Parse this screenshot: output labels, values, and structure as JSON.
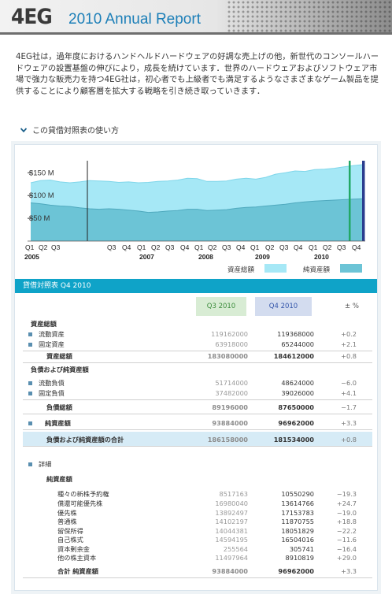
{
  "header": {
    "logo": "4EG",
    "title": "2010 Annual Report"
  },
  "intro": "4EG社は，過年度におけるハンドヘルドハードウェアの好調な売上げの他，新世代のコンソールハードウェアの設置基盤の伸びにより，成長を続けています．世界のハードウェアおよびソフトウェア市場で強力な販売力を持つ4EG社は，初心者でも上級者でも満足するようなさまざまなゲーム製品を提供することにより顧客層を拡大する戦略を引き続き取っていきます．",
  "howto": "この貸借対照表の使い方",
  "colors": {
    "accent": "#0fa3c8",
    "light_area": "#a6e8f6",
    "dark_area": "#6cc4d6",
    "marker_green": "#22a865",
    "marker_navy": "#2a3d8f"
  },
  "chart_data": {
    "type": "area",
    "y_ticks": [
      "$150 M",
      "$100 M",
      "$50 M"
    ],
    "x_quarter_labels": [
      "Q1",
      "Q2",
      "Q3",
      "Q3",
      "Q4",
      "Q1",
      "Q2",
      "Q3",
      "Q4",
      "Q1",
      "Q2",
      "Q3",
      "Q4",
      "Q1",
      "Q2",
      "Q3",
      "Q4",
      "Q1",
      "Q2",
      "Q3",
      "Q4"
    ],
    "year_labels": [
      "2005",
      "2007",
      "2008",
      "2009",
      "2010"
    ],
    "series": [
      {
        "name": "資産総額",
        "values": [
          128,
          133,
          134,
          130,
          128,
          130,
          133,
          132,
          131,
          129,
          130,
          128,
          129,
          131,
          132,
          134,
          138,
          137,
          131,
          131,
          132,
          136,
          138,
          136,
          140,
          147,
          150,
          154,
          153,
          157,
          158,
          160,
          163,
          166,
          168
        ]
      },
      {
        "name": "純資産額",
        "values": [
          84,
          82,
          79,
          77,
          76,
          73,
          71,
          70,
          71,
          70,
          68,
          66,
          63,
          64,
          66,
          67,
          70,
          70,
          67,
          68,
          69,
          72,
          74,
          75,
          77,
          79,
          81,
          84,
          86,
          88,
          89,
          90,
          91,
          92,
          93
        ]
      }
    ],
    "ylim": [
      0,
      180
    ]
  },
  "legend": {
    "total_assets": "資産総額",
    "net_assets": "純資産額"
  },
  "table": {
    "title": "貸借対照表 Q4 2010",
    "col_q3": "Q3 2010",
    "col_q4": "Q4 2010",
    "col_pct": "± %",
    "rows": [
      {
        "label": "資産総額",
        "type": "section"
      },
      {
        "label": "流動資産",
        "q3": "119162000",
        "q4": "119368000",
        "pct": "+0.2",
        "type": "bullet"
      },
      {
        "label": "固定資産",
        "q3": "63918000",
        "q4": "65244000",
        "pct": "+2.1",
        "type": "bullet"
      },
      {
        "label": "資産総額",
        "q3": "183080000",
        "q4": "184612000",
        "pct": "+0.8",
        "type": "total"
      },
      {
        "label": "負債および純資産額",
        "type": "section"
      },
      {
        "label": "流動負債",
        "q3": "51714000",
        "q4": "48624000",
        "pct": "−6.0",
        "type": "bullet"
      },
      {
        "label": "固定負債",
        "q3": "37482000",
        "q4": "39026000",
        "pct": "+4.1",
        "type": "bullet"
      },
      {
        "label": "負債総額",
        "q3": "89196000",
        "q4": "87650000",
        "pct": "−1.7",
        "type": "total"
      },
      {
        "label": "純資産額",
        "q3": "93884000",
        "q4": "96962000",
        "pct": "+3.3",
        "type": "totalbullet"
      },
      {
        "label": "負債および純資産額の合計",
        "q3": "186158000",
        "q4": "181534000",
        "pct": "+0.8",
        "type": "grand"
      },
      {
        "label": "詳細",
        "type": "detailtoggle"
      },
      {
        "label": "純資産額",
        "type": "subsection"
      },
      {
        "label": "種々の新株予約権",
        "q3": "8517163",
        "q4": "10550290",
        "pct": "−19.3",
        "type": "detail"
      },
      {
        "label": "償還可能優先株",
        "q3": "16980040",
        "q4": "13614766",
        "pct": "+24.7",
        "type": "detail"
      },
      {
        "label": "優先株",
        "q3": "13892497",
        "q4": "17153783",
        "pct": "−19.0",
        "type": "detail"
      },
      {
        "label": "普通株",
        "q3": "14102197",
        "q4": "11870755",
        "pct": "+18.8",
        "type": "detail"
      },
      {
        "label": "留保所得",
        "q3": "14044381",
        "q4": "18051829",
        "pct": "−22.2",
        "type": "detail"
      },
      {
        "label": "自己株式",
        "q3": "14594195",
        "q4": "16504016",
        "pct": "−11.6",
        "type": "detail"
      },
      {
        "label": "資本剰余金",
        "q3": "255564",
        "q4": "305741",
        "pct": "−16.4",
        "type": "detail"
      },
      {
        "label": "他の株主資本",
        "q3": "11497964",
        "q4": "8910819",
        "pct": "+29.0",
        "type": "detail"
      },
      {
        "label": "合計 純資産額",
        "q3": "93884000",
        "q4": "96962000",
        "pct": "+3.3",
        "type": "detailtotal"
      }
    ]
  }
}
